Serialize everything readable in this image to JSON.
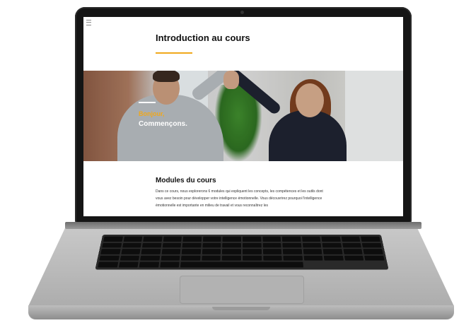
{
  "course_page": {
    "title": "Introduction au cours",
    "hero": {
      "greeting": "Bonjour,",
      "subtitle": "Commençons."
    },
    "modules": {
      "heading": "Modules du cours",
      "body": "Dans ce cours, nous explorerons 6 modules qui expliquent les concepts, les compétences et les outils dont vous avez besoin pour développer votre intelligence émotionnelle. Vous découvrirez pourquoi l'intelligence émotionnelle est importante en milieu de travail et vous reconnaîtrez les"
    }
  },
  "icons": {
    "menu": "hamburger-menu-icon"
  },
  "colors": {
    "accent": "#f0a81c",
    "heading": "#111111",
    "laptop_bezel": "#151515",
    "laptop_body": "#bdbdbd"
  }
}
